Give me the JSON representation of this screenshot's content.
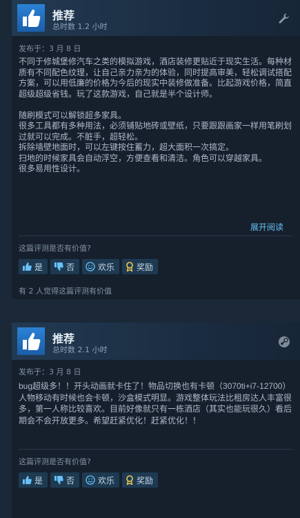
{
  "reviews": [
    {
      "recommendation": "推荐",
      "hours": "总时数 1.2 小时",
      "posted": "发布于：3 月 8 日",
      "paragraphs": [
        "不同于修城堡修汽车之类的模拟游戏，酒店装修更贴近于现实生活。每种材质有不同配色纹理，让自己亲力亲为的体验，同时提高审美，轻松调试搭配方案，可以用低廉的价格为今后的现实中装修做准备。比起游戏价格，简直超级超级省钱。玩了这款游戏，自己就是半个设计师。",
        "随刷模式可以解锁超多家具。\n很多工具都有多种用法，必须铺贴地砖或壁纸，只要跟跟画家一样用笔刷划过就可以完成。不脏手，超轻松。\n拆除墙壁地面时，可以左键按住蓄力，超大面积一次搞定。\n扫地的时候家具会自动浮空，方便查看和清洁。角色可以穿越家具。\n很多易用性设计。"
      ],
      "expand": "展开阅读",
      "helpful_question": "这篇评测是否有价值?",
      "buttons": {
        "yes": "是",
        "no": "否",
        "funny": "欢乐",
        "award": "奖励"
      },
      "found_helpful": "有 2 人觉得这篇评测有价值",
      "platform_icon": "wrench-icon"
    },
    {
      "recommendation": "推荐",
      "hours": "总时数 2.1 小时",
      "posted": "发布于：3 月 8 日",
      "paragraphs": [
        "bug超级多！！开头动画就卡住了！物品切换也有卡顿（3070ti+i7-12700）人物移动有时候也会卡顿，沙盒模式明显。游戏整体玩法比租房达人丰富很多，第一人称比较喜欢。目前好像就只有一栋酒店（其实也能玩很久）看后期会不会开放更多。希望赶紧优化！赶紧优化！！"
      ],
      "helpful_question": "这篇评测是否有价值?",
      "buttons": {
        "yes": "是",
        "no": "否",
        "funny": "欢乐",
        "award": "奖励"
      },
      "platform_icon": "steam-icon"
    }
  ],
  "colors": {
    "background": "#1b2838",
    "card": "#16202d",
    "link": "#66c0f4",
    "thumb": "#2b82d6"
  }
}
